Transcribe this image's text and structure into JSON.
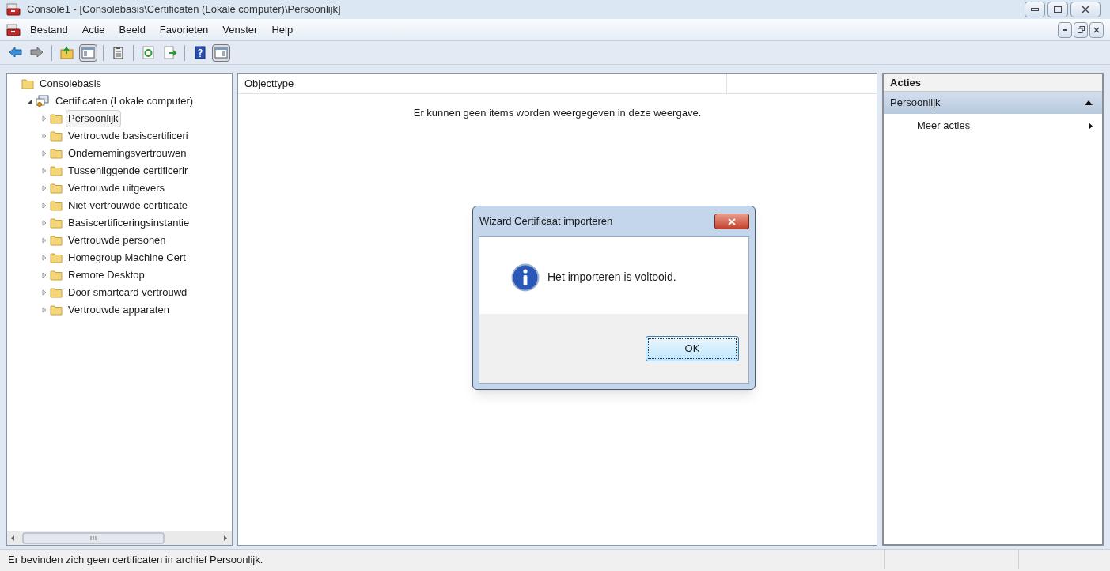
{
  "window": {
    "title": "Console1 - [Consolebasis\\Certificaten (Lokale computer)\\Persoonlijk]"
  },
  "menu": [
    "Bestand",
    "Actie",
    "Beeld",
    "Favorieten",
    "Venster",
    "Help"
  ],
  "toolbar": [
    {
      "kind": "back",
      "pressed": false
    },
    {
      "kind": "forward",
      "pressed": false
    },
    {
      "kind": "sep"
    },
    {
      "kind": "up",
      "pressed": false
    },
    {
      "kind": "tree",
      "pressed": true
    },
    {
      "kind": "sep"
    },
    {
      "kind": "clipboard",
      "pressed": false
    },
    {
      "kind": "sep"
    },
    {
      "kind": "refresh",
      "pressed": false
    },
    {
      "kind": "export",
      "pressed": false
    },
    {
      "kind": "sep"
    },
    {
      "kind": "help",
      "pressed": false
    },
    {
      "kind": "pane",
      "pressed": true
    }
  ],
  "tree": [
    {
      "label": "Consolebasis",
      "kind": "folder",
      "selected": false,
      "children": [
        {
          "label": "Certificaten (Lokale computer)",
          "kind": "certs",
          "selected": false,
          "expanded": true,
          "children": [
            {
              "label": "Persoonlijk",
              "kind": "folder",
              "selected": true,
              "expanded": false
            },
            {
              "label": "Vertrouwde basiscertificeri",
              "kind": "folder",
              "selected": false,
              "expanded": false
            },
            {
              "label": "Ondernemingsvertrouwen",
              "kind": "folder",
              "selected": false,
              "expanded": false
            },
            {
              "label": "Tussenliggende certificerir",
              "kind": "folder",
              "selected": false,
              "expanded": false
            },
            {
              "label": "Vertrouwde uitgevers",
              "kind": "folder",
              "selected": false,
              "expanded": false
            },
            {
              "label": "Niet-vertrouwde certificate",
              "kind": "folder",
              "selected": false,
              "expanded": false
            },
            {
              "label": "Basiscertificeringsinstantie",
              "kind": "folder",
              "selected": false,
              "expanded": false
            },
            {
              "label": "Vertrouwde personen",
              "kind": "folder",
              "selected": false,
              "expanded": false
            },
            {
              "label": "Homegroup Machine Cert",
              "kind": "folder",
              "selected": false,
              "expanded": false
            },
            {
              "label": "Remote Desktop",
              "kind": "folder",
              "selected": false,
              "expanded": false
            },
            {
              "label": "Door smartcard vertrouwd",
              "kind": "folder",
              "selected": false,
              "expanded": false
            },
            {
              "label": "Vertrouwde apparaten",
              "kind": "folder",
              "selected": false,
              "expanded": false
            }
          ]
        }
      ]
    }
  ],
  "list": {
    "columns": [
      "Objecttype"
    ],
    "empty_message": "Er kunnen geen items worden weergegeven in deze weergave."
  },
  "actions": {
    "title": "Acties",
    "sections": [
      {
        "label": "Persoonlijk",
        "expanded": true,
        "items": [
          {
            "label": "Meer acties",
            "submenu": true
          }
        ]
      }
    ]
  },
  "dialog": {
    "title": "Wizard Certificaat importeren",
    "message": "Het importeren is voltooid.",
    "buttons": [
      {
        "label": "OK",
        "default": true
      }
    ]
  },
  "status_bar": {
    "text": "Er bevinden zich geen certificaten in archief Persoonlijk."
  }
}
